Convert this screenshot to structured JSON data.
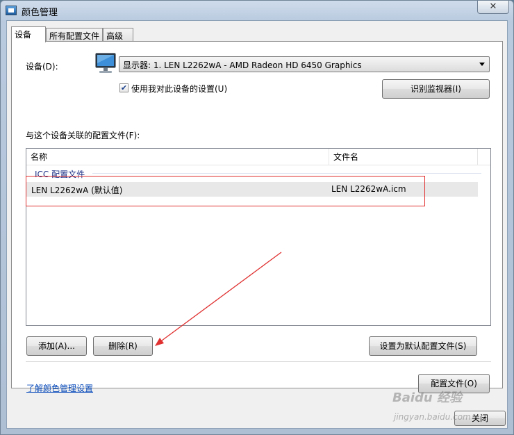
{
  "window": {
    "title": "颜色管理",
    "close_glyph": "✕"
  },
  "tabs": [
    {
      "label": "设备",
      "active": true
    },
    {
      "label": "所有配置文件",
      "active": false
    },
    {
      "label": "高级",
      "active": false
    }
  ],
  "device": {
    "label": "设备(D):",
    "selected": "显示器: 1. LEN L2262wA - AMD Radeon HD 6450 Graphics",
    "checkbox_label": "使用我对此设备的设置(U)",
    "checkbox_checked": true,
    "identify_button": "识别监视器(I)"
  },
  "profiles": {
    "section_label": "与这个设备关联的配置文件(F):",
    "columns": [
      "名称",
      "文件名"
    ],
    "group": "ICC 配置文件",
    "rows": [
      {
        "name": "LEN L2262wA (默认值)",
        "file": "LEN L2262wA.icm"
      }
    ]
  },
  "buttons": {
    "add": "添加(A)...",
    "remove": "删除(R)",
    "set_default": "设置为默认配置文件(S)",
    "profiles": "配置文件(O)",
    "close": "关闭"
  },
  "link": "了解颜色管理设置",
  "watermark": {
    "brand": "Baidu 经验",
    "url": "jingyan.baidu.com"
  },
  "icons": {
    "checkbox": "checkmark-icon",
    "dropdown": "chevron-down-icon",
    "monitor": "monitor-icon"
  }
}
